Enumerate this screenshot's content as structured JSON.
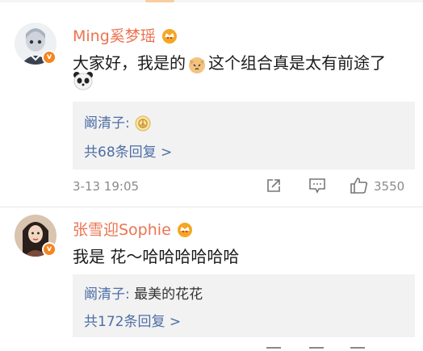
{
  "comments": [
    {
      "username": "Ming奚梦瑶",
      "text_a": "大家好，我是的",
      "text_b": "这个组合真是太有前途了",
      "reply_name": "阚清子:",
      "reply_text": "",
      "reply_icon": "peace-emoji",
      "more_replies": "共68条回复 >",
      "time": "3-13 19:05",
      "likes": "3550"
    },
    {
      "username": "张雪迎Sophie",
      "text_a": "我是 花～哈哈哈哈哈哈",
      "reply_name": "阚清子:",
      "reply_text": " 最美的花花",
      "more_replies": "共172条回复 >"
    }
  ],
  "colors": {
    "username": "#eb7350",
    "link": "#4e6ea5",
    "reply_bg": "#f2f2f2",
    "vip": "#f5851f"
  },
  "icons": [
    "crown-icon",
    "verified-icon",
    "cat-emoji",
    "panda-emoji",
    "share-icon",
    "comment-icon",
    "like-icon"
  ]
}
